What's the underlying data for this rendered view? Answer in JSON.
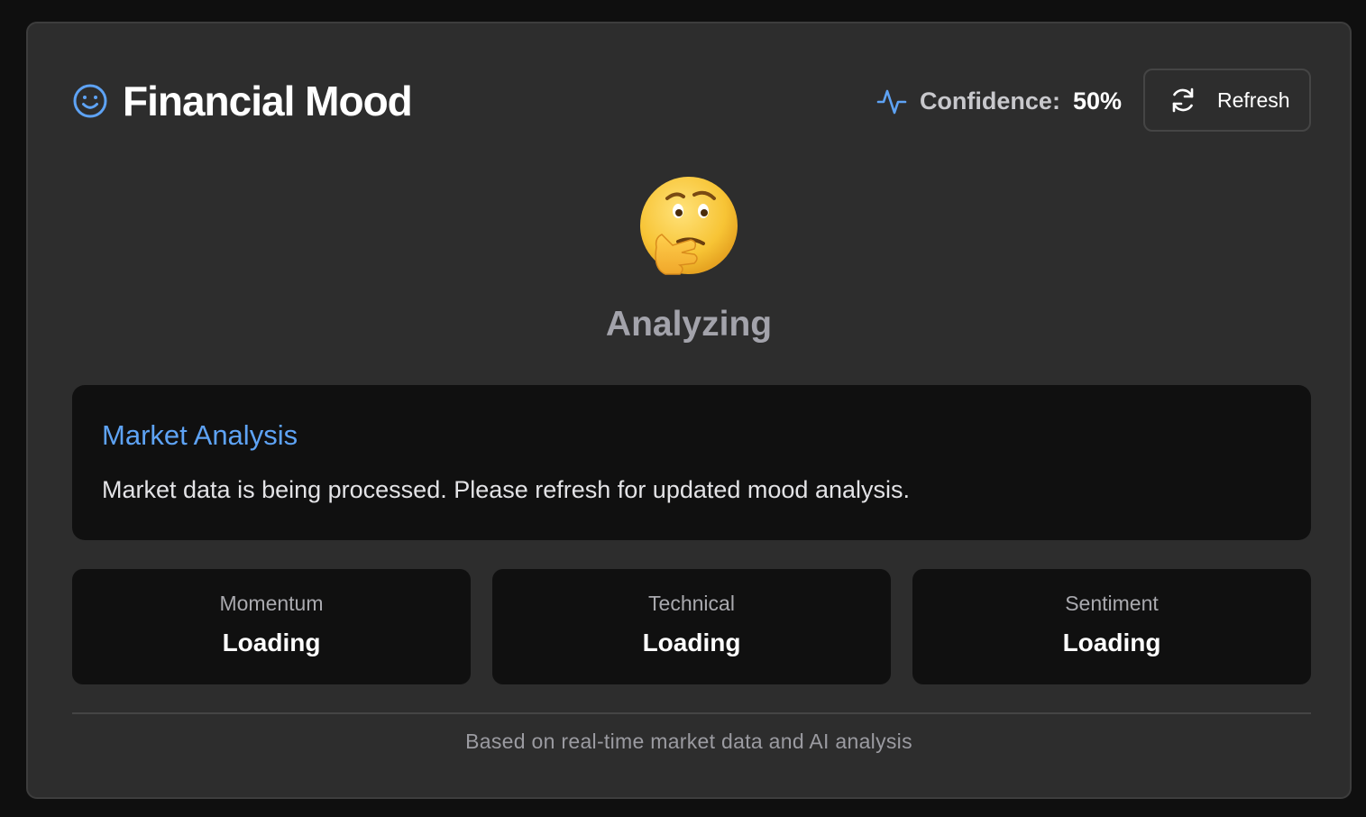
{
  "header": {
    "title": "Financial Mood",
    "title_icon": "smile-icon",
    "confidence_icon": "pulse-icon",
    "confidence_label": "Confidence:",
    "confidence_value": "50%",
    "refresh_label": "Refresh",
    "refresh_icon": "refresh-icon"
  },
  "mood": {
    "emoji": "thinking-face",
    "label": "Analyzing"
  },
  "analysis": {
    "title": "Market Analysis",
    "text": "Market data is being processed. Please refresh for updated mood analysis."
  },
  "stats": [
    {
      "label": "Momentum",
      "value": "Loading"
    },
    {
      "label": "Technical",
      "value": "Loading"
    },
    {
      "label": "Sentiment",
      "value": "Loading"
    }
  ],
  "footer": {
    "note": "Based on real-time market data and AI analysis"
  },
  "colors": {
    "accent": "#5ea3f5",
    "card_bg": "#2d2d2d",
    "panel_bg": "#101010",
    "emoji_yellow": "#f7c435"
  }
}
